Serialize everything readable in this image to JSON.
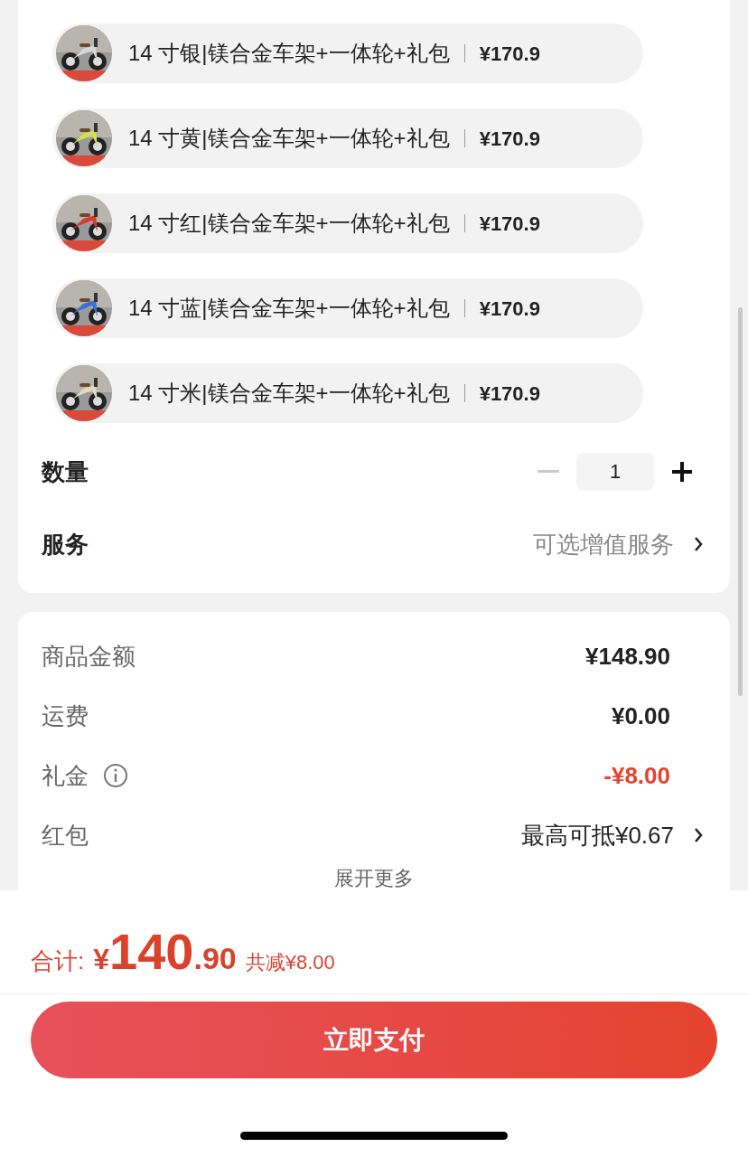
{
  "options": [
    {
      "label": "14 寸银|镁合金车架+一体轮+礼包",
      "price": "¥170.9",
      "selected": false
    },
    {
      "label": "14 寸黄|镁合金车架+一体轮+礼包",
      "price": "¥170.9",
      "selected": false
    },
    {
      "label": "14 寸红|镁合金车架+一体轮+礼包",
      "price": "¥170.9",
      "selected": false
    },
    {
      "label": "14 寸蓝|镁合金车架+一体轮+礼包",
      "price": "¥170.9",
      "selected": false
    },
    {
      "label": "14 寸米|镁合金车架+一体轮+礼包",
      "price": "¥170.9",
      "selected": false
    }
  ],
  "quantity": {
    "label": "数量",
    "value": "1",
    "minus_disabled": true
  },
  "service": {
    "label": "服务",
    "placeholder": "可选增值服务"
  },
  "price_rows": [
    {
      "label": "商品金额",
      "value": "¥148.90",
      "kind": "plain",
      "info": false
    },
    {
      "label": "运费",
      "value": "¥0.00",
      "kind": "plain",
      "info": false
    },
    {
      "label": "礼金",
      "value": "-¥8.00",
      "kind": "discount",
      "info": true
    },
    {
      "label": "红包",
      "value": "最高可抵¥0.67",
      "kind": "link",
      "info": false
    }
  ],
  "expand": "展开更多",
  "total": {
    "label": "合计:",
    "currency": "¥",
    "integer": "140",
    "decimals": ".90",
    "saving": "共减¥8.00"
  },
  "pay_button": "立即支付"
}
